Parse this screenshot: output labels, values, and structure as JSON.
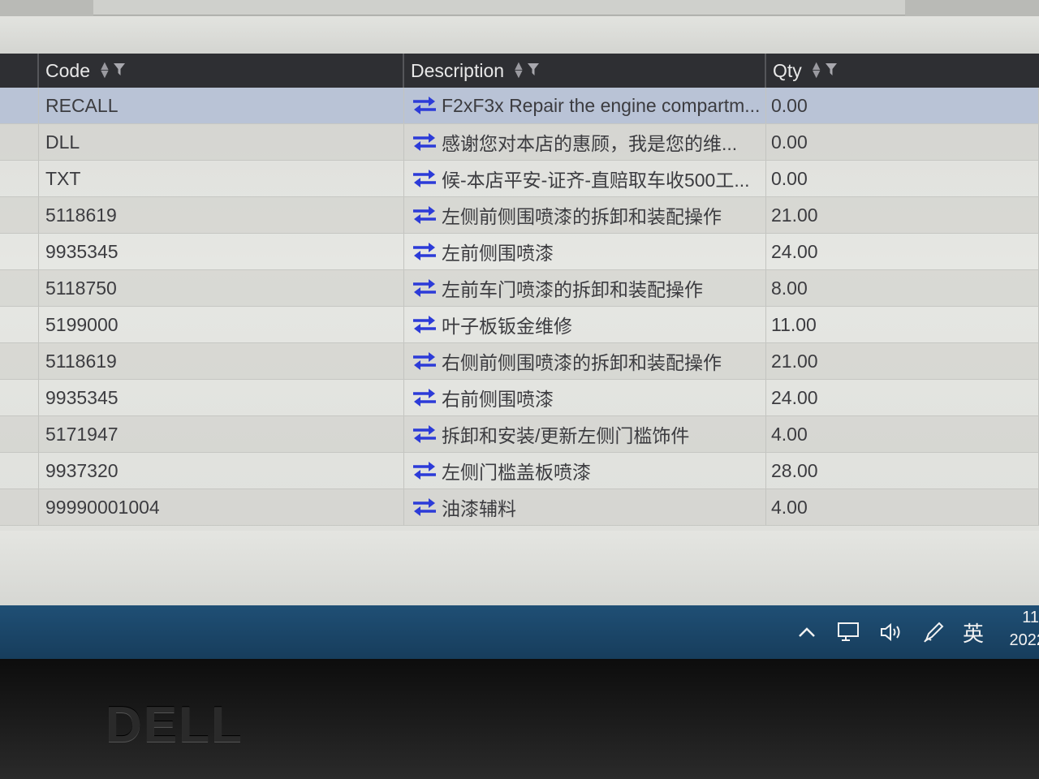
{
  "columns": {
    "code": "Code",
    "description": "Description",
    "qty": "Qty"
  },
  "rows": [
    {
      "code": "RECALL",
      "description": "F2xF3x Repair the engine compartm...",
      "qty": "0.00"
    },
    {
      "code": "DLL",
      "description": "感谢您对本店的惠顾，我是您的维...",
      "qty": "0.00"
    },
    {
      "code": "TXT",
      "description": "候-本店平安-证齐-直赔取车收500工...",
      "qty": "0.00"
    },
    {
      "code": "5118619",
      "description": "左侧前侧围喷漆的拆卸和装配操作",
      "qty": "21.00"
    },
    {
      "code": "9935345",
      "description": "左前侧围喷漆",
      "qty": "24.00"
    },
    {
      "code": "5118750",
      "description": "左前车门喷漆的拆卸和装配操作",
      "qty": "8.00"
    },
    {
      "code": "5199000",
      "description": "叶子板钣金维修",
      "qty": "11.00"
    },
    {
      "code": "5118619",
      "description": "右侧前侧围喷漆的拆卸和装配操作",
      "qty": "21.00"
    },
    {
      "code": "9935345",
      "description": "右前侧围喷漆",
      "qty": "24.00"
    },
    {
      "code": "5171947",
      "description": "拆卸和安装/更新左侧门槛饰件",
      "qty": "4.00"
    },
    {
      "code": "9937320",
      "description": "左侧门槛盖板喷漆",
      "qty": "28.00"
    },
    {
      "code": "99990001004",
      "description": "油漆辅料",
      "qty": "4.00"
    }
  ],
  "taskbar": {
    "ime": "英",
    "time": "11",
    "date": "2022"
  },
  "bezel": {
    "logo": "DELL"
  },
  "icons": {
    "row_icon": "swap-arrows-icon",
    "sort": "sort-icon",
    "filter": "filter-icon"
  },
  "colors": {
    "header_bg": "#2e2f33",
    "selected_row": "#b9c3d6",
    "swap_icon": "#2c3bd8",
    "taskbar": "#1f4f75"
  }
}
